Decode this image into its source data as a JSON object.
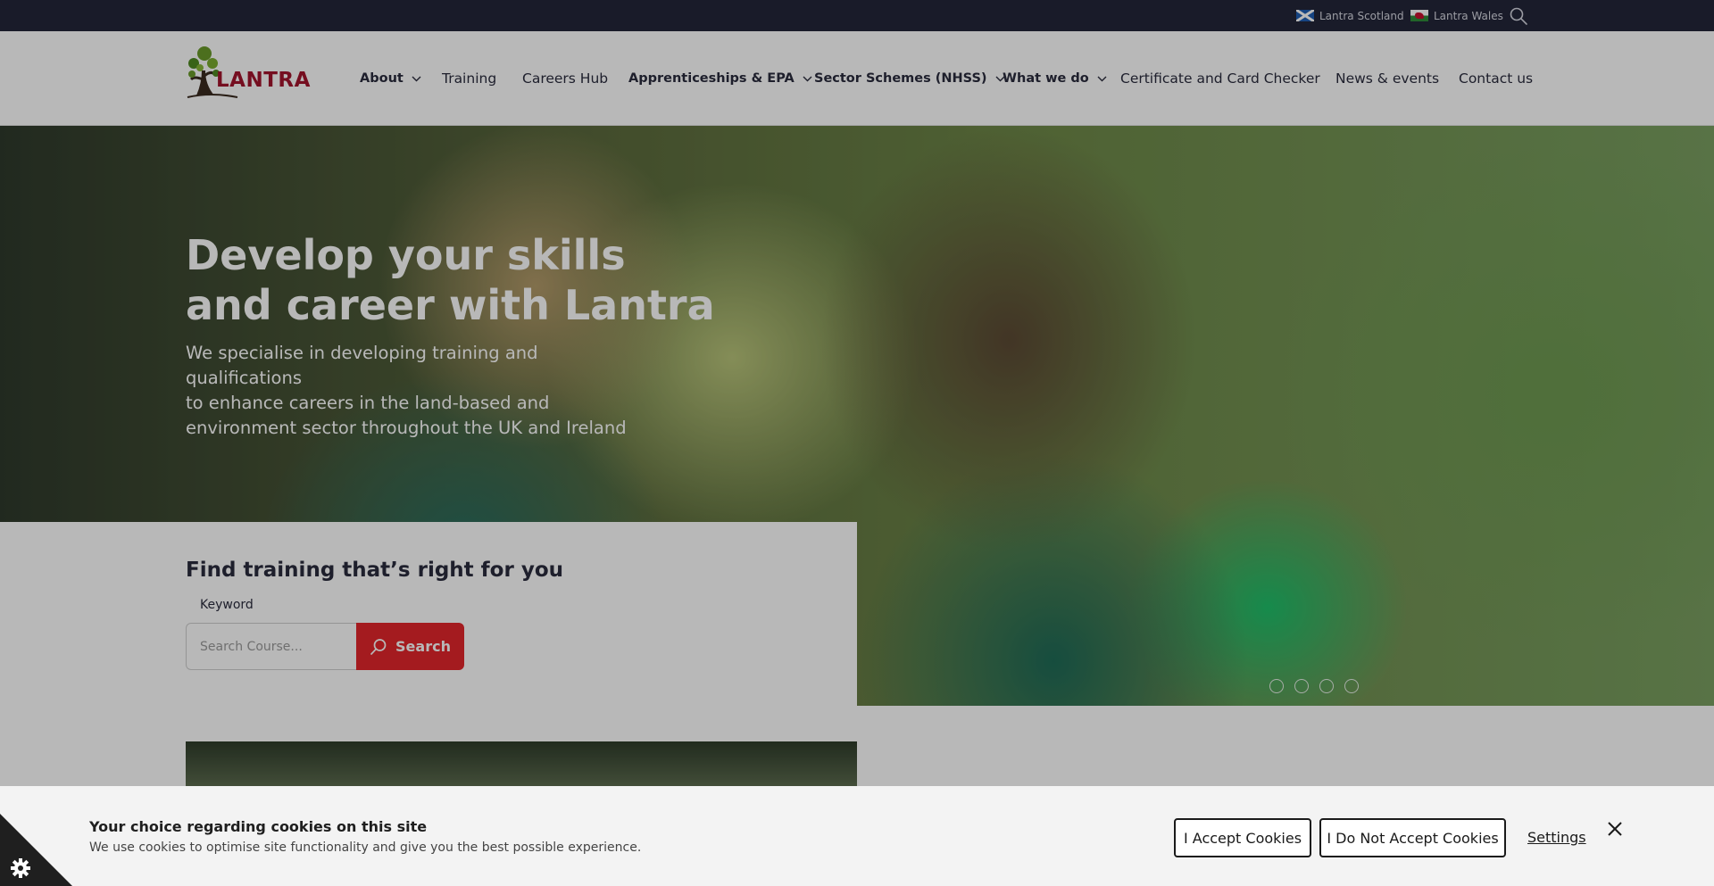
{
  "topbar": {
    "scotland_label": "Lantra Scotland",
    "wales_label": "Lantra Wales"
  },
  "header": {
    "logo_text": "LANTRA",
    "nav": [
      {
        "label": "About"
      },
      {
        "label": "Training"
      },
      {
        "label": "Careers Hub"
      },
      {
        "label": "Apprenticeships & EPA"
      },
      {
        "label": "Sector Schemes (NHSS)"
      },
      {
        "label": "What we do"
      },
      {
        "label": "Certificate and Card Checker"
      },
      {
        "label": "News & events"
      },
      {
        "label": "Contact us"
      }
    ]
  },
  "hero": {
    "title_line1": "Develop your skills",
    "title_line2": "and career with Lantra",
    "sub_line1": "We specialise in developing training and qualifications",
    "sub_line2": "to enhance careers in the land-based and",
    "sub_line3": "environment sector throughout the UK and Ireland"
  },
  "finder": {
    "title": "Find training that’s right for you",
    "keyword_label": "Keyword",
    "search_placeholder": "Search Course...",
    "search_button": "Search"
  },
  "cookie": {
    "title": "Your choice regarding cookies on this site",
    "text": "We use cookies to optimise site functionality and give you the best possible experience.",
    "accept": "I Accept Cookies",
    "decline": "I Do Not Accept Cookies",
    "settings": "Settings"
  },
  "icons": {
    "scotland_flag": "scotland-flag-icon",
    "wales_flag": "wales-flag-icon",
    "search": "search-icon",
    "chevron": "chevron-down-icon",
    "close": "close-icon",
    "cookie_settings": "gear-icon"
  },
  "colors": {
    "topbar": "#23263a",
    "accent_red": "#e3262b",
    "logo_red": "#a3142d",
    "cookie_bg": "#f3f3f3"
  }
}
